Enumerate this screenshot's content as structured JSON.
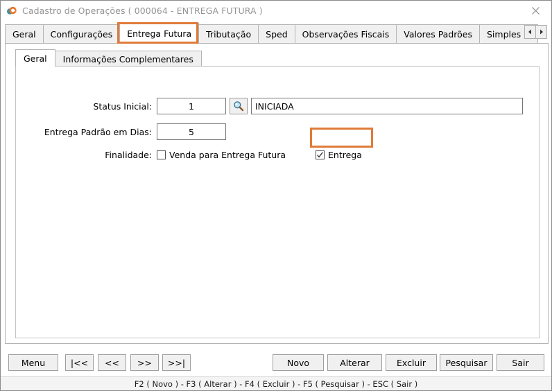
{
  "window": {
    "title": "Cadastro de Operações ( 000064 - ENTREGA FUTURA )",
    "app_icon": "app-icon",
    "close_icon": "close-icon"
  },
  "outer_tabs": [
    {
      "label": "Geral",
      "selected": false
    },
    {
      "label": "Configurações",
      "selected": false
    },
    {
      "label": "Entrega Futura",
      "selected": true
    },
    {
      "label": "Tributação",
      "selected": false
    },
    {
      "label": "Sped",
      "selected": false
    },
    {
      "label": "Observações Fiscais",
      "selected": false
    },
    {
      "label": "Valores Padrões",
      "selected": false
    },
    {
      "label": "Simples N",
      "selected": false
    }
  ],
  "tab_scrollers": {
    "left_icon": "chevron-left-icon",
    "right_icon": "chevron-right-icon"
  },
  "inner_tabs": [
    {
      "label": "Geral",
      "selected": true
    },
    {
      "label": "Informações Complementares",
      "selected": false
    }
  ],
  "form": {
    "status_inicial": {
      "label": "Status Inicial:",
      "code_value": "1",
      "lookup_icon": "magnifier-icon",
      "description_value": "INICIADA"
    },
    "entrega_padrao": {
      "label": "Entrega Padrão em Dias:",
      "value": "5"
    },
    "finalidade": {
      "label": "Finalidade:",
      "option_venda": {
        "label": "Venda para Entrega Futura",
        "checked": false
      },
      "option_entrega": {
        "label": "Entrega",
        "checked": true
      }
    }
  },
  "buttons": {
    "menu": "Menu",
    "nav_first": "|<<",
    "nav_prev": "<<",
    "nav_next": ">>",
    "nav_last": ">>|",
    "novo": "Novo",
    "alterar": "Alterar",
    "excluir": "Excluir",
    "pesquisar": "Pesquisar",
    "sair": "Sair"
  },
  "statusbar": {
    "text": "F2 ( Novo )  -  F3 ( Alterar )  -  F4 ( Excluir )  -  F5 ( Pesquisar )  -  ESC ( Sair )"
  },
  "colors": {
    "highlight": "#e07b39",
    "titlebar_text": "#949494",
    "control_face": "#f0f0f0",
    "window_bg": "#ffffff"
  }
}
